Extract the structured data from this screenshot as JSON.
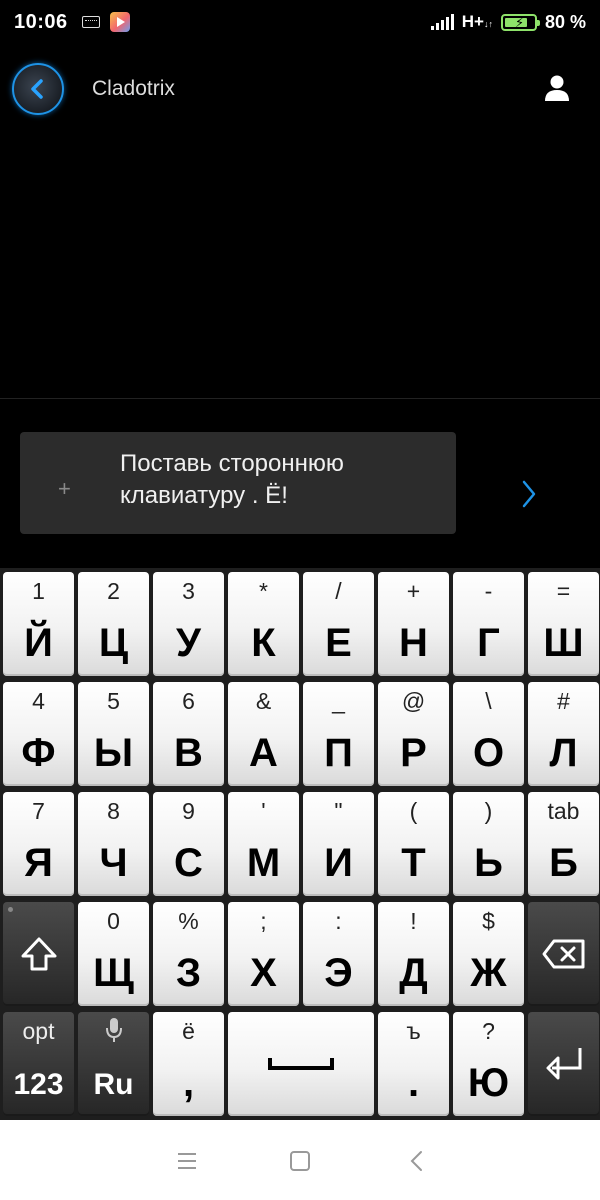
{
  "status_bar": {
    "time": "10:06",
    "network": "H+",
    "network_sub": "↓↑",
    "battery_level": 0.8,
    "battery_text": "80 %",
    "colors": {
      "battery": "#8ee26a"
    }
  },
  "header": {
    "title": "Cladotrix",
    "back_icon": "back-arrow-icon",
    "user_icon": "user-icon",
    "accent": "#1e93e6"
  },
  "composer": {
    "plus_icon": "+",
    "message_line1": "Поставь стороннюю",
    "message_line2": "клавиатуру . Ё!",
    "send_icon": "chevron-right-icon"
  },
  "keyboard": {
    "rows": [
      [
        {
          "secondary": "1",
          "primary": "Й"
        },
        {
          "secondary": "2",
          "primary": "Ц"
        },
        {
          "secondary": "3",
          "primary": "У"
        },
        {
          "secondary": "*",
          "primary": "К"
        },
        {
          "secondary": "/",
          "primary": "Е"
        },
        {
          "secondary": "+",
          "primary": "Н"
        },
        {
          "secondary": "-",
          "primary": "Г"
        },
        {
          "secondary": "=",
          "primary": "Ш"
        }
      ],
      [
        {
          "secondary": "4",
          "primary": "Ф"
        },
        {
          "secondary": "5",
          "primary": "Ы"
        },
        {
          "secondary": "6",
          "primary": "В"
        },
        {
          "secondary": "&",
          "primary": "А"
        },
        {
          "secondary": "_",
          "primary": "П"
        },
        {
          "secondary": "@",
          "primary": "Р"
        },
        {
          "secondary": "\\",
          "primary": "О"
        },
        {
          "secondary": "#",
          "primary": "Л"
        }
      ],
      [
        {
          "secondary": "7",
          "primary": "Я"
        },
        {
          "secondary": "8",
          "primary": "Ч"
        },
        {
          "secondary": "9",
          "primary": "С"
        },
        {
          "secondary": "'",
          "primary": "М"
        },
        {
          "secondary": "\"",
          "primary": "И"
        },
        {
          "secondary": "(",
          "primary": "Т"
        },
        {
          "secondary": ")",
          "primary": "Ь"
        },
        {
          "secondary": "tab",
          "primary": "Б"
        }
      ],
      [
        {
          "secondary": "",
          "primary": "",
          "icon": "shift-icon",
          "dark": true
        },
        {
          "secondary": "0",
          "primary": "Щ"
        },
        {
          "secondary": "%",
          "primary": "З"
        },
        {
          "secondary": ";",
          "primary": "Х"
        },
        {
          "secondary": ":",
          "primary": "Э"
        },
        {
          "secondary": "!",
          "primary": "Д"
        },
        {
          "secondary": "$",
          "primary": "Ж"
        },
        {
          "secondary": "",
          "primary": "",
          "icon": "backspace-icon",
          "dark": true
        }
      ],
      [
        {
          "secondary": "opt",
          "primary": "123",
          "dark": true
        },
        {
          "secondary": "",
          "primary": "Ru",
          "icon": "mic-icon",
          "dark": true
        },
        {
          "secondary": "ё",
          "primary": ","
        },
        {
          "secondary": "",
          "primary": "",
          "icon": "space-icon",
          "wide": true
        },
        {
          "secondary": "ъ",
          "primary": "."
        },
        {
          "secondary": "?",
          "primary": "Ю"
        },
        {
          "secondary": "",
          "primary": "",
          "icon": "enter-icon",
          "dark": true
        }
      ]
    ]
  },
  "nav_bar": {
    "menu_icon": "menu-icon",
    "home_icon": "home-square-icon",
    "back_icon": "nav-back-icon"
  }
}
